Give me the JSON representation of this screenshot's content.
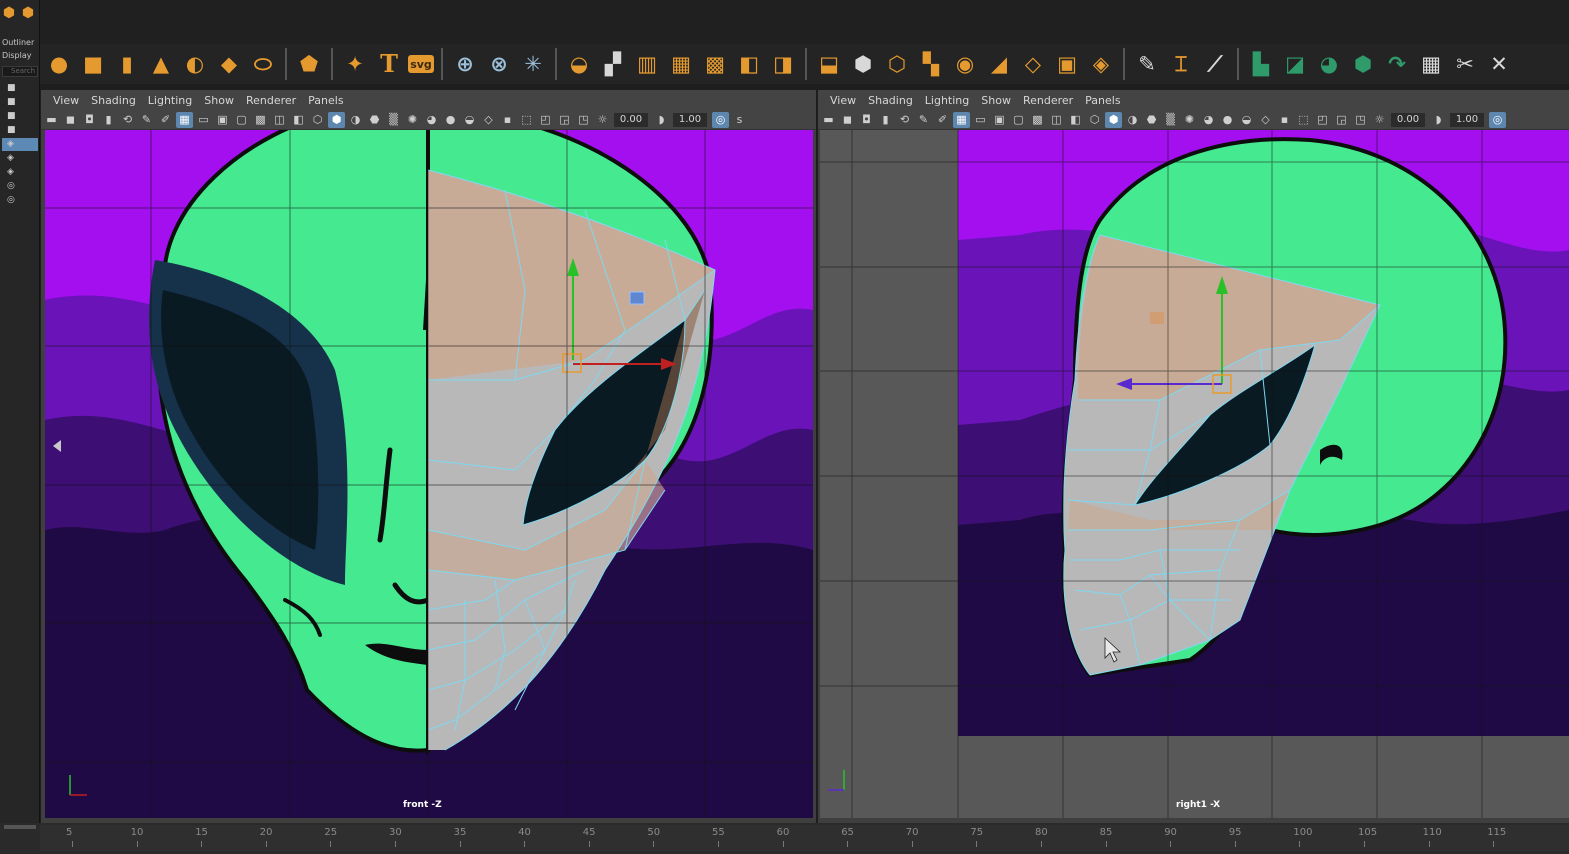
{
  "left_strip": {
    "outliner_label": "Outliner",
    "display_label": "Display",
    "search_placeholder": "Search"
  },
  "viewport_left": {
    "menu": [
      "View",
      "Shading",
      "Lighting",
      "Show",
      "Renderer",
      "Panels"
    ],
    "field_a": "0.00",
    "field_b": "1.00",
    "camera_label": "front -Z"
  },
  "viewport_right": {
    "menu": [
      "View",
      "Shading",
      "Lighting",
      "Show",
      "Renderer",
      "Panels"
    ],
    "field_a": "0.00",
    "field_b": "1.00",
    "camera_label": "right1 -X"
  },
  "timeline": {
    "ticks": [
      "5",
      "10",
      "15",
      "20",
      "25",
      "30",
      "35",
      "40",
      "45",
      "50",
      "55",
      "60",
      "65",
      "70",
      "75",
      "80",
      "85",
      "90",
      "95",
      "100",
      "105",
      "110",
      "115"
    ]
  },
  "colors": {
    "alien_green": "#45ea90",
    "sky_magenta": "#a40ff0",
    "mesh_wire": "#7fd8f0",
    "eye_dark": "#0a1a22"
  }
}
